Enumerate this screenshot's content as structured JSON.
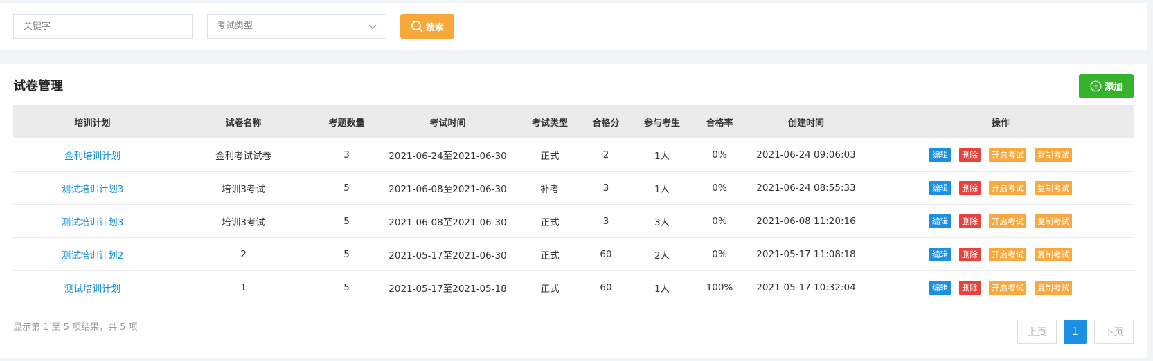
{
  "search": {
    "keyword_placeholder": "关键字",
    "exam_type_placeholder": "考试类型",
    "search_label": "搜索"
  },
  "panel": {
    "title": "试卷管理",
    "add_label": "添加"
  },
  "table": {
    "headers": [
      "培训计划",
      "试卷名称",
      "考题数量",
      "考试时间",
      "考试类型",
      "合格分",
      "参与考生",
      "合格率",
      "创建时间",
      "操作"
    ],
    "rows": [
      {
        "plan": "金利培训计划",
        "paper": "金利考试试卷",
        "count": "3",
        "time": "2021-06-24至2021-06-30",
        "type": "正式",
        "pass_score": "2",
        "examinees": "1人",
        "pass_rate": "0%",
        "created": "2021-06-24 09:06:03"
      },
      {
        "plan": "测试培训计划3",
        "paper": "培训3考试",
        "count": "5",
        "time": "2021-06-08至2021-06-30",
        "type": "补考",
        "pass_score": "3",
        "examinees": "1人",
        "pass_rate": "0%",
        "created": "2021-06-24 08:55:33"
      },
      {
        "plan": "测试培训计划3",
        "paper": "培训3考试",
        "count": "5",
        "time": "2021-06-08至2021-06-30",
        "type": "正式",
        "pass_score": "3",
        "examinees": "3人",
        "pass_rate": "0%",
        "created": "2021-06-08 11:20:16"
      },
      {
        "plan": "测试培训计划2",
        "paper": "2",
        "count": "5",
        "time": "2021-05-17至2021-06-30",
        "type": "正式",
        "pass_score": "60",
        "examinees": "2人",
        "pass_rate": "0%",
        "created": "2021-05-17 11:08:18"
      },
      {
        "plan": "测试培训计划",
        "paper": "1",
        "count": "5",
        "time": "2021-05-17至2021-05-18",
        "type": "正式",
        "pass_score": "60",
        "examinees": "1人",
        "pass_rate": "100%",
        "created": "2021-05-17 10:32:04"
      }
    ],
    "actions": {
      "edit": "编辑",
      "delete": "删除",
      "start": "开启考试",
      "copy": "复制考试"
    }
  },
  "pagination": {
    "summary": "显示第 1 至 5 项结果，共 5 项",
    "prev": "上页",
    "current": "1",
    "next": "下页"
  },
  "colors": {
    "accent_blue": "#1a8fe3",
    "search_orange": "#f7a83a",
    "add_green": "#36b32c",
    "delete_red": "#e9413d",
    "link_blue": "#1a8fd6"
  }
}
